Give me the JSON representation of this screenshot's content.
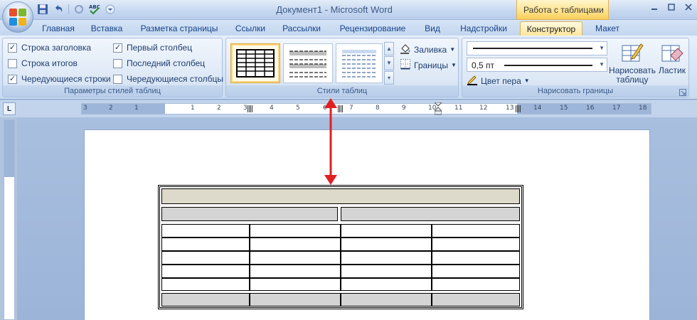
{
  "window": {
    "title": "Документ1 - Microsoft Word",
    "context_tab_title": "Работа с таблицами",
    "controls": [
      "minimize-icon",
      "maximize-icon",
      "close-icon"
    ]
  },
  "quick_access": [
    "save-icon",
    "undo-icon",
    "redo-icon",
    "spelling-icon",
    "customize-icon"
  ],
  "tabs": [
    {
      "label": "Главная",
      "active": false
    },
    {
      "label": "Вставка",
      "active": false
    },
    {
      "label": "Разметка страницы",
      "active": false
    },
    {
      "label": "Ссылки",
      "active": false
    },
    {
      "label": "Рассылки",
      "active": false
    },
    {
      "label": "Рецензирование",
      "active": false
    },
    {
      "label": "Вид",
      "active": false
    },
    {
      "label": "Надстройки",
      "active": false
    },
    {
      "label": "Конструктор",
      "active": true
    },
    {
      "label": "Макет",
      "active": false
    }
  ],
  "ribbon": {
    "table_style_options": {
      "label": "Параметры стилей таблиц",
      "options": [
        {
          "label": "Строка заголовка",
          "checked": true
        },
        {
          "label": "Строка итогов",
          "checked": false
        },
        {
          "label": "Чередующиеся строки",
          "checked": true
        },
        {
          "label": "Первый столбец",
          "checked": true
        },
        {
          "label": "Последний столбец",
          "checked": false
        },
        {
          "label": "Чередующиеся столбцы",
          "checked": false
        }
      ]
    },
    "table_styles": {
      "label": "Стили таблиц",
      "shading_label": "Заливка",
      "borders_label": "Границы"
    },
    "draw_borders": {
      "label": "Нарисовать границы",
      "line_weight": "0,5 пт",
      "pen_color_label": "Цвет пера",
      "draw_table_label": "Нарисовать таблицу",
      "eraser_label": "Ластик"
    }
  },
  "ruler": {
    "corner_symbol": "L",
    "numbers": [
      "3",
      "2",
      "1",
      "1",
      "2",
      "3",
      "4",
      "5",
      "6",
      "7",
      "8",
      "9",
      "10",
      "11",
      "12",
      "13",
      "14",
      "15",
      "16",
      "17",
      "18"
    ]
  },
  "colors": {
    "annotation_arrow": "#e02020",
    "active_tab": "#ffe79c",
    "header_row": "#dddacb",
    "shaded_row": "#d4d4d4"
  }
}
